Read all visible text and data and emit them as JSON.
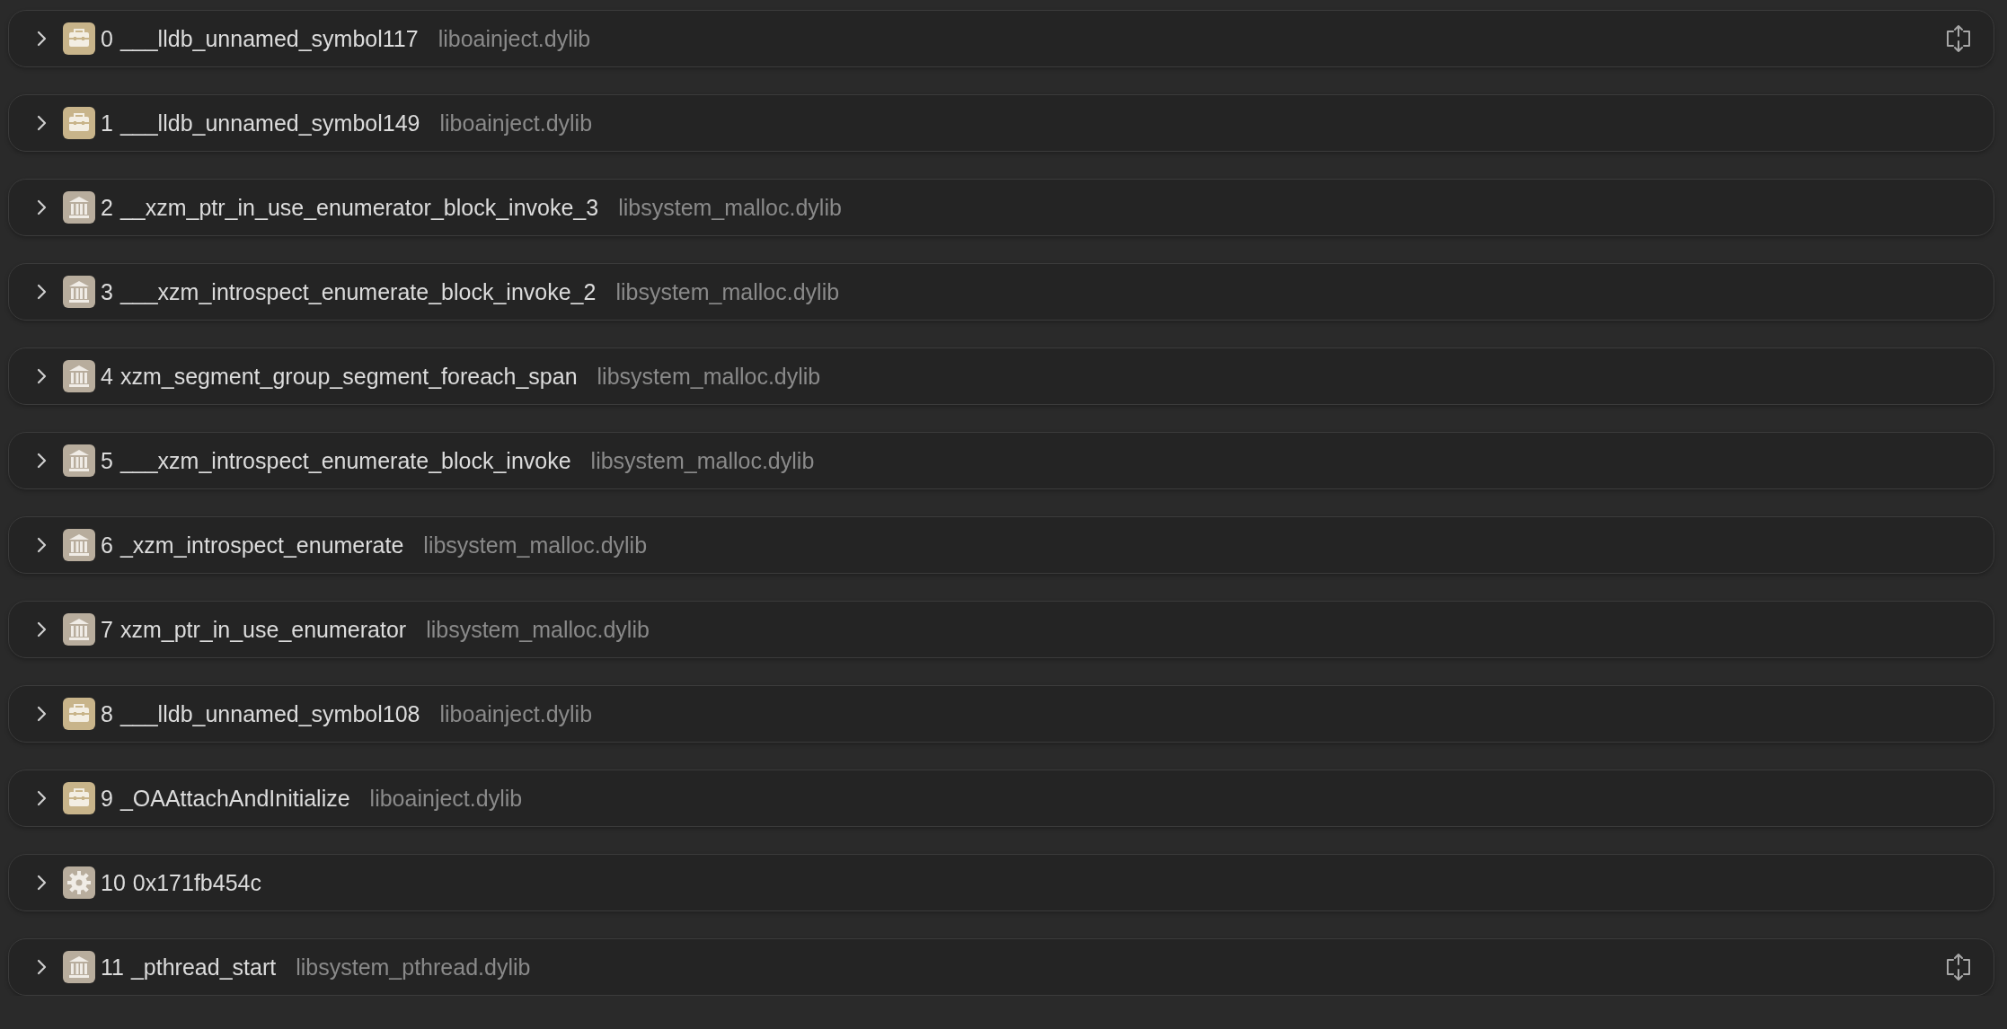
{
  "frames": [
    {
      "index": "0",
      "symbol": "___lldb_unnamed_symbol117",
      "library": "liboainject.dylib",
      "kind": "toolbox",
      "expanded": false,
      "action": true
    },
    {
      "index": "1",
      "symbol": "___lldb_unnamed_symbol149",
      "library": "liboainject.dylib",
      "kind": "toolbox",
      "expanded": false,
      "action": false
    },
    {
      "index": "2",
      "symbol": "__xzm_ptr_in_use_enumerator_block_invoke_3",
      "library": "libsystem_malloc.dylib",
      "kind": "library",
      "expanded": false,
      "action": false
    },
    {
      "index": "3",
      "symbol": "___xzm_introspect_enumerate_block_invoke_2",
      "library": "libsystem_malloc.dylib",
      "kind": "library",
      "expanded": false,
      "action": false
    },
    {
      "index": "4",
      "symbol": "xzm_segment_group_segment_foreach_span",
      "library": "libsystem_malloc.dylib",
      "kind": "library",
      "expanded": false,
      "action": false
    },
    {
      "index": "5",
      "symbol": "___xzm_introspect_enumerate_block_invoke",
      "library": "libsystem_malloc.dylib",
      "kind": "library",
      "expanded": false,
      "action": false
    },
    {
      "index": "6",
      "symbol": "_xzm_introspect_enumerate",
      "library": "libsystem_malloc.dylib",
      "kind": "library",
      "expanded": false,
      "action": false
    },
    {
      "index": "7",
      "symbol": "xzm_ptr_in_use_enumerator",
      "library": "libsystem_malloc.dylib",
      "kind": "library",
      "expanded": false,
      "action": false
    },
    {
      "index": "8",
      "symbol": "___lldb_unnamed_symbol108",
      "library": "liboainject.dylib",
      "kind": "toolbox",
      "expanded": false,
      "action": false
    },
    {
      "index": "9",
      "symbol": "_OAAttachAndInitialize",
      "library": "liboainject.dylib",
      "kind": "toolbox",
      "expanded": false,
      "action": false
    },
    {
      "index": "10",
      "symbol": "0x171fb454c",
      "kind": "gear",
      "expanded": false,
      "action": false
    },
    {
      "index": "11",
      "symbol": "_pthread_start",
      "library": "libsystem_pthread.dylib",
      "kind": "library",
      "expanded": false,
      "action": true
    }
  ]
}
